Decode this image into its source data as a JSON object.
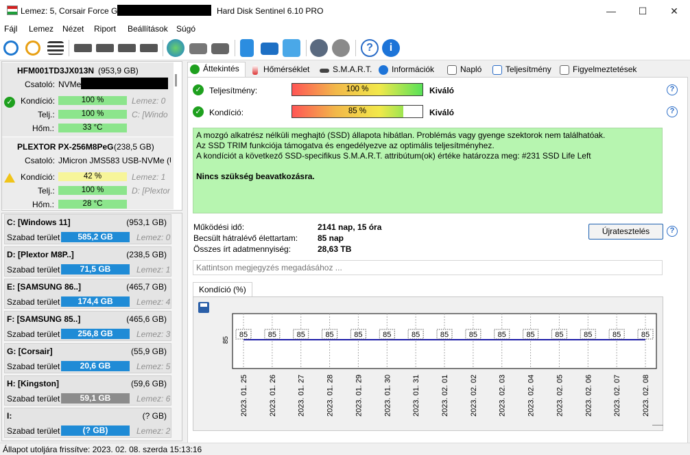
{
  "window": {
    "title_prefix": "Lemez: 5, Corsair Force GT",
    "product": "Hard Disk Sentinel 6.10 PRO",
    "minimize": "—",
    "maximize": "☐",
    "close": "✕"
  },
  "menu": [
    "Fájl",
    "Lemez",
    "Nézet",
    "Riport",
    "Beállítások",
    "Súgó"
  ],
  "toolbar_icons": [
    "refresh-icon",
    "refresh-warning-icon",
    "disk-list-icon",
    "disk-icon",
    "disk-clock-icon",
    "disk-check-icon",
    "disk-search-icon",
    "globe-icon",
    "network-disk-icon",
    "usb-disk-icon",
    "report-icon",
    "mail-icon",
    "network-icon",
    "settings-icon",
    "sound-icon",
    "help-icon",
    "info-icon"
  ],
  "disks": [
    {
      "name": "HFM001TD3JX013N",
      "size": "(953,9 GB)",
      "connector_label": "Csatoló:",
      "connector": "NVMe",
      "condition_label": "Kondíció:",
      "condition": "100 %",
      "condition_pct": 100,
      "perf_label": "Telj.:",
      "perf": "100 %",
      "temp_label": "Hőm.:",
      "temp": "33 °C",
      "disk_index": "Lemez: 0",
      "drive": "C: [Windo"
    },
    {
      "name": "PLEXTOR PX-256M8PeG",
      "size": "(238,5 GB)",
      "connector_label": "Csatoló:",
      "connector": "JMicron JMS583 USB-NVMe (U",
      "condition_label": "Kondíció:",
      "condition": "42 %",
      "condition_pct": 42,
      "perf_label": "Telj.:",
      "perf": "100 %",
      "temp_label": "Hőm.:",
      "temp": "28 °C",
      "disk_index": "Lemez: 1",
      "drive": "D: [Plextor"
    }
  ],
  "partitions": [
    {
      "name": "C: [Windows 11]",
      "size": "(953,1 GB)",
      "free_label": "Szabad terület",
      "free": "585,2 GB",
      "disk": "Lemez: 0",
      "color": "#1f8bd6"
    },
    {
      "name": "D: [Plextor M8P..]",
      "size": "(238,5 GB)",
      "free_label": "Szabad terület",
      "free": "71,5 GB",
      "disk": "Lemez: 1",
      "color": "#1f8bd6"
    },
    {
      "name": "E: [SAMSUNG 86..]",
      "size": "(465,7 GB)",
      "free_label": "Szabad terület",
      "free": "174,4 GB",
      "disk": "Lemez: 4",
      "color": "#1f8bd6"
    },
    {
      "name": "F: [SAMSUNG 85..]",
      "size": "(465,6 GB)",
      "free_label": "Szabad terület",
      "free": "256,8 GB",
      "disk": "Lemez: 3",
      "color": "#1f8bd6"
    },
    {
      "name": "G: [Corsair]",
      "size": "(55,9 GB)",
      "free_label": "Szabad terület",
      "free": "20,6 GB",
      "disk": "Lemez: 5",
      "color": "#1f8bd6"
    },
    {
      "name": "H: [Kingston]",
      "size": "(59,6 GB)",
      "free_label": "Szabad terület",
      "free": "59,1 GB",
      "disk": "Lemez: 6",
      "color": "#8c8c8c"
    },
    {
      "name": "I:",
      "size": "(? GB)",
      "free_label": "Szabad terület",
      "free": "(? GB)",
      "disk": "Lemez: 2",
      "color": "#1f8bd6"
    }
  ],
  "tabs": [
    "Áttekintés",
    "Hőmérséklet",
    "S.M.A.R.T.",
    "Információk",
    "Napló",
    "Teljesítmény",
    "Figyelmeztetések"
  ],
  "overview": {
    "perf_label": "Teljesítmény:",
    "perf_value": "100 %",
    "perf_pct": 100,
    "perf_rating": "Kiváló",
    "cond_label": "Kondíció:",
    "cond_value": "85 %",
    "cond_pct": 85,
    "cond_rating": "Kiváló",
    "status_lines": [
      "A mozgó alkatrész nélküli meghajtó (SSD) állapota hibátlan. Problémás vagy gyenge szektorok nem találhatóak.",
      "Az SSD TRIM funkciója támogatva és engedélyezve az optimális teljesítményhez.",
      "A kondíciót a következő SSD-specifikus S.M.A.R.T. attribútum(ok) értéke határozza meg:  #231 SSD Life Left"
    ],
    "status_action": "Nincs szükség beavatkozásra.",
    "uptime_label": "Működési idő:",
    "uptime": "2141 nap, 15 óra",
    "remaining_label": "Becsült hátralévő élettartam:",
    "remaining": "85 nap",
    "written_label": "Összes írt adatmennyiség:",
    "written": "28,63 TB",
    "restart_button": "Újratesztelés",
    "comment_placeholder": "Kattintson megjegyzés megadásához ...",
    "chart_tab": "Kondíció  (%)"
  },
  "chart_data": {
    "type": "line",
    "x": [
      "2023. 01. 25",
      "2023. 01. 26",
      "2023. 01. 27",
      "2023. 01. 28",
      "2023. 01. 29",
      "2023. 01. 30",
      "2023. 01. 31",
      "2023. 02. 01",
      "2023. 02. 02",
      "2023. 02. 03",
      "2023. 02. 04",
      "2023. 02. 05",
      "2023. 02. 06",
      "2023. 02. 07",
      "2023. 02. 08"
    ],
    "series": [
      {
        "values": [
          85,
          85,
          85,
          85,
          85,
          85,
          85,
          85,
          85,
          85,
          85,
          85,
          85,
          85,
          85
        ]
      }
    ],
    "yticks": [
      "85"
    ],
    "color": "#1a1aa6"
  },
  "statusbar": "Állapot utoljára frissítve: 2023. 02. 08. szerda 15:13:16"
}
